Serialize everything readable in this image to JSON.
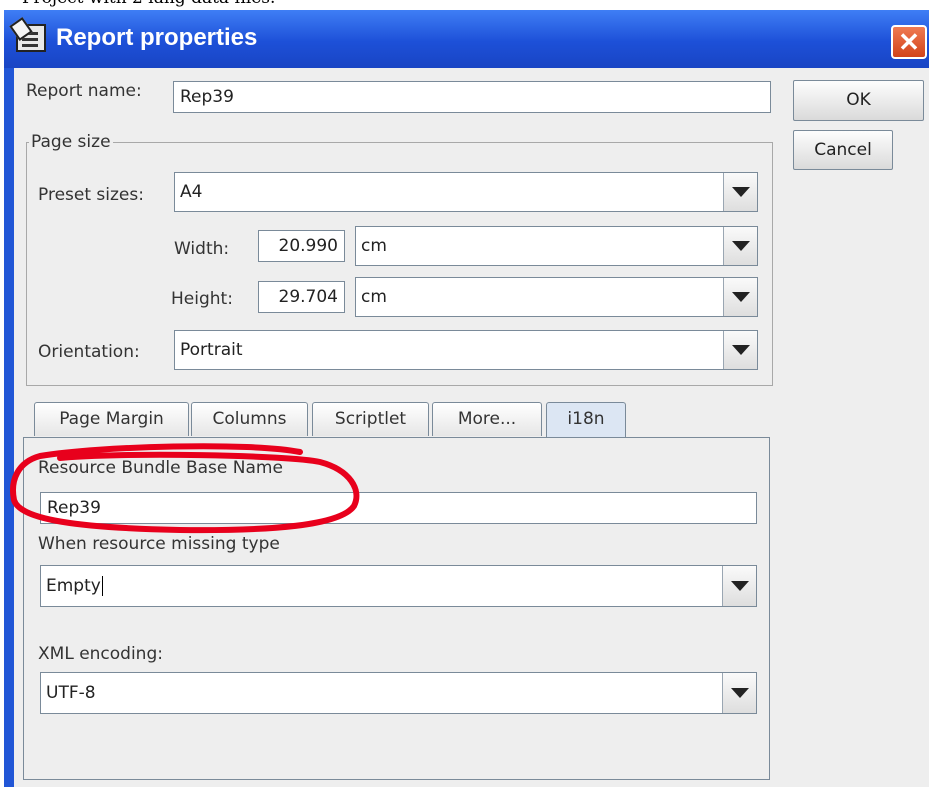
{
  "window": {
    "title": "Report properties",
    "close_glyph": "✕",
    "top_strip_text": "Project with 2 lang data files."
  },
  "buttons": {
    "ok": "OK",
    "cancel": "Cancel"
  },
  "report_name": {
    "label": "Report name:",
    "value": "Rep39"
  },
  "page_size": {
    "legend": "Page size",
    "preset_label": "Preset sizes:",
    "preset_value": "A4",
    "width_label": "Width:",
    "width_value": "20.990",
    "width_unit": "cm",
    "height_label": "Height:",
    "height_value": "29.704",
    "height_unit": "cm",
    "orientation_label": "Orientation:",
    "orientation_value": "Portrait"
  },
  "tabs": [
    {
      "label": "Page Margin",
      "active": false
    },
    {
      "label": "Columns",
      "active": false
    },
    {
      "label": "Scriptlet",
      "active": false
    },
    {
      "label": "More...",
      "active": false
    },
    {
      "label": "i18n",
      "active": true
    }
  ],
  "i18n": {
    "bundle_label": "Resource Bundle Base Name",
    "bundle_value": "Rep39",
    "missing_label": "When resource missing type",
    "missing_value": "Empty",
    "encoding_label": "XML encoding:",
    "encoding_value": "UTF-8"
  },
  "colors": {
    "titlebar": "#2156d6",
    "dialog_bg": "#eeeeee",
    "close_button": "#d9532b",
    "highlight_ellipse": "#e8001c"
  },
  "icons": {
    "title": "report-icon",
    "close": "close-icon",
    "dropdown": "chevron-down-icon"
  }
}
